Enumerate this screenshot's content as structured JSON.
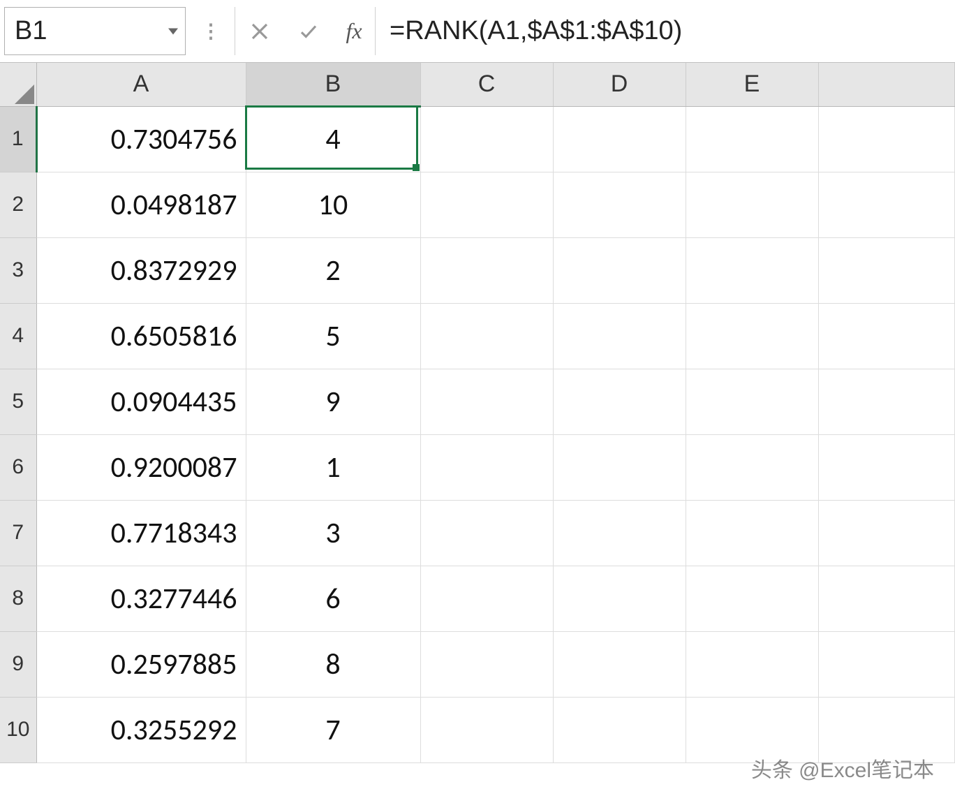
{
  "formula_bar": {
    "cell_reference": "B1",
    "fx_label": "fx",
    "formula": "=RANK(A1,$A$1:$A$10)"
  },
  "columns": [
    "A",
    "B",
    "C",
    "D",
    "E"
  ],
  "active_column": "B",
  "active_row": "1",
  "rows": [
    {
      "num": "1",
      "A": "0.7304756",
      "B": "4"
    },
    {
      "num": "2",
      "A": "0.0498187",
      "B": "10"
    },
    {
      "num": "3",
      "A": "0.8372929",
      "B": "2"
    },
    {
      "num": "4",
      "A": "0.6505816",
      "B": "5"
    },
    {
      "num": "5",
      "A": "0.0904435",
      "B": "9"
    },
    {
      "num": "6",
      "A": "0.9200087",
      "B": "1"
    },
    {
      "num": "7",
      "A": "0.7718343",
      "B": "3"
    },
    {
      "num": "8",
      "A": "0.3277446",
      "B": "6"
    },
    {
      "num": "9",
      "A": "0.2597885",
      "B": "8"
    },
    {
      "num": "10",
      "A": "0.3255292",
      "B": "7"
    }
  ],
  "watermark": "头条 @Excel笔记本"
}
